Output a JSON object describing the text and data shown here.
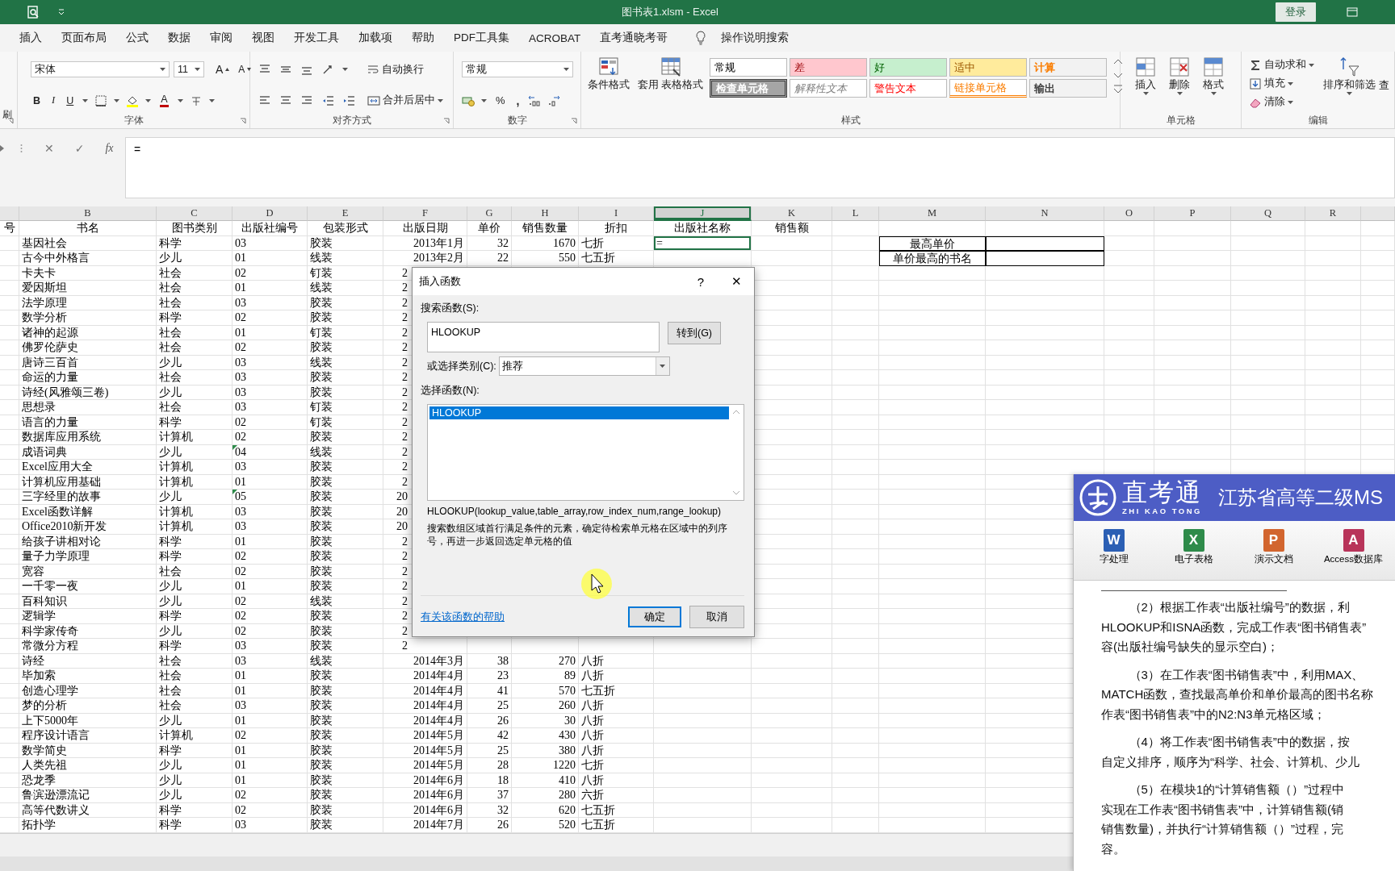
{
  "window": {
    "title": "图书表1.xlsm  -  Excel",
    "login": "登录"
  },
  "menu_tabs": [
    {
      "label": "插入",
      "selected": false
    },
    {
      "label": "页面布局",
      "selected": false
    },
    {
      "label": "公式",
      "selected": false
    },
    {
      "label": "数据",
      "selected": false
    },
    {
      "label": "审阅",
      "selected": false
    },
    {
      "label": "视图",
      "selected": false
    },
    {
      "label": "开发工具",
      "selected": false
    },
    {
      "label": "加载项",
      "selected": false
    },
    {
      "label": "帮助",
      "selected": false
    },
    {
      "label": "PDF工具集",
      "selected": false
    },
    {
      "label": "ACROBAT",
      "selected": false
    },
    {
      "label": "直考通晓考哥",
      "selected": false
    }
  ],
  "tell_me": "操作说明搜索",
  "ribbon": {
    "clipboard_stub": "刷",
    "font": {
      "label": "字体",
      "font_name": "宋体",
      "font_size": "11",
      "grow": "A",
      "shrink": "A",
      "bold": "B",
      "italic": "I",
      "underline": "U",
      "font_color": "A"
    },
    "alignment": {
      "label": "对齐方式",
      "wrap": "自动换行",
      "merge": "合并后居中"
    },
    "number": {
      "label": "数字",
      "format": "常规",
      "percent": "%",
      "comma": ","
    },
    "styles": {
      "label": "样式",
      "conditional": "条件格式",
      "table": "套用\n表格格式",
      "cell_styles": [
        {
          "label": "常规",
          "color": "#ffffff",
          "kind": "normal"
        },
        {
          "label": "差",
          "color": "#ffc7ce",
          "kind": "bad"
        },
        {
          "label": "好",
          "color": "#c6efce",
          "kind": "good"
        },
        {
          "label": "适中",
          "color": "#ffeb9c",
          "kind": "neutral"
        },
        {
          "label": "计算",
          "color": "#f2f2f2",
          "kind": "calculation"
        },
        {
          "label": "检查单元格",
          "color": "#a5a5a5",
          "kind": "check"
        },
        {
          "label": "解释性文本",
          "color": "#ffffff",
          "kind": "explanatory"
        },
        {
          "label": "警告文本",
          "color": "#ffffff",
          "kind": "warning"
        },
        {
          "label": "链接单元格",
          "color": "#ffffff",
          "kind": "linked"
        },
        {
          "label": "输出",
          "color": "#f2f2f2",
          "kind": "output"
        }
      ]
    },
    "cells": {
      "label": "单元格",
      "buttons": [
        "插入",
        "删除",
        "格式"
      ]
    },
    "editing": {
      "label": "编辑",
      "autosum": "自动求和",
      "fill": "填充",
      "clear": "清除",
      "sort": "排序和筛选",
      "find": "查"
    }
  },
  "formula_bar": {
    "cancel": "✕",
    "enter": "✓",
    "function": "fx",
    "value": "="
  },
  "sheet": {
    "columns": [
      "B",
      "C",
      "D",
      "E",
      "F",
      "G",
      "H",
      "I",
      "J",
      "K",
      "L",
      "M",
      "N",
      "O",
      "P",
      "Q",
      "R"
    ],
    "summary_labels": [
      "最高单价",
      "单价最高的书名"
    ],
    "rows": [
      {
        "A": "号",
        "B": "书名",
        "C": "图书类别",
        "D": "出版社编号",
        "E": "包装形式",
        "F": "出版日期",
        "G": "单价",
        "H": "销售数量",
        "I": "折扣",
        "J": "出版社名称",
        "K": "销售额"
      },
      {
        "B": "基因社会",
        "C": "科学",
        "D": "03",
        "E": "胶装",
        "F": "2013年1月",
        "G": "32",
        "H": "1670",
        "I": "七折",
        "J": {
          "text": "=",
          "selected": true
        }
      },
      {
        "B": "古今中外格言",
        "C": "少儿",
        "D": "01",
        "E": "线装",
        "F": "2013年2月",
        "G": "22",
        "H": "550",
        "I": "七五折"
      },
      {
        "B": "卡夫卡",
        "C": "社会",
        "D": "02",
        "E": "钉装",
        "F": {
          "text": "2",
          "partial": true
        }
      },
      {
        "B": "爱因斯坦",
        "C": "社会",
        "D": "01",
        "E": "线装",
        "F": {
          "text": "2",
          "partial": true
        }
      },
      {
        "B": "法学原理",
        "C": "社会",
        "D": "03",
        "E": "胶装",
        "F": {
          "text": "2",
          "partial": true
        }
      },
      {
        "B": "数学分析",
        "C": "科学",
        "D": "02",
        "E": "胶装",
        "F": {
          "text": "2",
          "partial": true
        }
      },
      {
        "B": "诸神的起源",
        "C": "社会",
        "D": "01",
        "E": "钉装",
        "F": {
          "text": "2",
          "partial": true
        }
      },
      {
        "B": "佛罗伦萨史",
        "C": "社会",
        "D": "02",
        "E": "胶装",
        "F": {
          "text": "2",
          "partial": true
        }
      },
      {
        "B": "唐诗三百首",
        "C": "少儿",
        "D": "03",
        "E": "线装",
        "F": {
          "text": "2",
          "partial": true
        }
      },
      {
        "B": "命运的力量",
        "C": "社会",
        "D": "03",
        "E": "胶装",
        "F": {
          "text": "2",
          "partial": true
        }
      },
      {
        "B": "诗经(风雅颂三卷)",
        "C": "少儿",
        "D": "03",
        "E": "胶装",
        "F": {
          "text": "2",
          "partial": true
        }
      },
      {
        "B": "思想录",
        "C": "社会",
        "D": "03",
        "E": "钉装",
        "F": {
          "text": "2",
          "partial": true
        }
      },
      {
        "B": "语言的力量",
        "C": "科学",
        "D": "02",
        "E": "钉装",
        "F": {
          "text": "2",
          "partial": true
        }
      },
      {
        "B": "数据库应用系统",
        "C": "计算机",
        "D": "02",
        "E": "胶装",
        "F": {
          "text": "2",
          "partial": true
        }
      },
      {
        "B": "成语词典",
        "C": "少儿",
        "D": {
          "text": "04",
          "error_flag": true
        },
        "E": "线装",
        "F": {
          "text": "2",
          "partial": true
        }
      },
      {
        "B": "Excel应用大全",
        "C": "计算机",
        "D": "03",
        "E": "胶装",
        "F": {
          "text": "2",
          "partial": true
        }
      },
      {
        "B": "计算机应用基础",
        "C": "计算机",
        "D": "01",
        "E": "胶装",
        "F": {
          "text": "2",
          "partial": true
        }
      },
      {
        "B": "三字经里的故事",
        "C": "少儿",
        "D": {
          "text": "05",
          "error_flag": true
        },
        "E": "胶装",
        "F": {
          "text": "20",
          "partial": true
        }
      },
      {
        "B": "Excel函数详解",
        "C": "计算机",
        "D": "03",
        "E": "胶装",
        "F": {
          "text": "20",
          "partial": true
        }
      },
      {
        "B": "Office2010新开发",
        "C": "计算机",
        "D": "03",
        "E": "胶装",
        "F": {
          "text": "20",
          "partial": true
        }
      },
      {
        "B": "给孩子讲相对论",
        "C": "科学",
        "D": "01",
        "E": "胶装",
        "F": {
          "text": "2",
          "partial": true
        }
      },
      {
        "B": "量子力学原理",
        "C": "科学",
        "D": "02",
        "E": "胶装",
        "F": {
          "text": "2",
          "partial": true
        }
      },
      {
        "B": "宽容",
        "C": "社会",
        "D": "02",
        "E": "胶装",
        "F": {
          "text": "2",
          "partial": true
        }
      },
      {
        "B": "一千零一夜",
        "C": "少儿",
        "D": "01",
        "E": "胶装",
        "F": {
          "text": "2",
          "partial": true
        }
      },
      {
        "B": "百科知识",
        "C": "少儿",
        "D": "02",
        "E": "线装",
        "F": {
          "text": "2",
          "partial": true
        }
      },
      {
        "B": "逻辑学",
        "C": "科学",
        "D": "02",
        "E": "胶装",
        "F": {
          "text": "2",
          "partial": true
        }
      },
      {
        "B": "科学家传奇",
        "C": "少儿",
        "D": "02",
        "E": "胶装",
        "F": {
          "text": "2",
          "partial": true
        }
      },
      {
        "B": "常微分方程",
        "C": "科学",
        "D": "03",
        "E": "胶装",
        "F": {
          "text": "2",
          "partial": true
        }
      },
      {
        "B": "诗经",
        "C": "社会",
        "D": "03",
        "E": "线装",
        "F": "2014年3月",
        "G": "38",
        "H": "270",
        "I": "八折"
      },
      {
        "B": "毕加索",
        "C": "社会",
        "D": "01",
        "E": "胶装",
        "F": "2014年4月",
        "G": "23",
        "H": "89",
        "I": "八折"
      },
      {
        "B": "创造心理学",
        "C": "社会",
        "D": "01",
        "E": "胶装",
        "F": "2014年4月",
        "G": "41",
        "H": "570",
        "I": "七五折"
      },
      {
        "B": "梦的分析",
        "C": "社会",
        "D": "03",
        "E": "胶装",
        "F": "2014年4月",
        "G": "25",
        "H": "260",
        "I": "八折"
      },
      {
        "B": "上下5000年",
        "C": "少儿",
        "D": "01",
        "E": "胶装",
        "F": "2014年4月",
        "G": "26",
        "H": "30",
        "I": "八折"
      },
      {
        "B": "程序设计语言",
        "C": "计算机",
        "D": "02",
        "E": "胶装",
        "F": "2014年5月",
        "G": "42",
        "H": "430",
        "I": "八折"
      },
      {
        "B": "数学简史",
        "C": "科学",
        "D": "01",
        "E": "胶装",
        "F": "2014年5月",
        "G": "25",
        "H": "380",
        "I": "八折"
      },
      {
        "B": "人类先祖",
        "C": "少儿",
        "D": "01",
        "E": "胶装",
        "F": "2014年5月",
        "G": "28",
        "H": "1220",
        "I": "七折"
      },
      {
        "B": "恐龙季",
        "C": "少儿",
        "D": "01",
        "E": "胶装",
        "F": "2014年6月",
        "G": "18",
        "H": "410",
        "I": "八折"
      },
      {
        "B": "鲁滨逊漂流记",
        "C": "少儿",
        "D": "02",
        "E": "胶装",
        "F": "2014年6月",
        "G": "37",
        "H": "280",
        "I": "六折"
      },
      {
        "B": "高等代数讲义",
        "C": "科学",
        "D": "02",
        "E": "胶装",
        "F": "2014年6月",
        "G": "32",
        "H": "620",
        "I": "七五折"
      },
      {
        "B": "拓扑学",
        "C": "科学",
        "D": "03",
        "E": "胶装",
        "F": "2014年7月",
        "G": "26",
        "H": "520",
        "I": "七五折"
      }
    ]
  },
  "dialog": {
    "title": "插入函数",
    "help": "?",
    "close": "✕",
    "search_label": "搜索函数(S):",
    "search_value": "HLOOKUP",
    "go": "转到(G)",
    "category_label": "或选择类别(C):",
    "category_value": "推荐",
    "list_label": "选择函数(N):",
    "functions": [
      {
        "label": "HLOOKUP",
        "selected": true
      }
    ],
    "signature": "HLOOKUP(lookup_value,table_array,row_index_num,range_lookup)",
    "description": "搜索数组区域首行满足条件的元素，确定待检索单元格在区域中的列序号，再进一步返回选定单元格的值",
    "help_link": "有关该函数的帮助",
    "ok": "确定",
    "cancel": "取消"
  },
  "panel": {
    "brand": "直考通",
    "brand_latin": "ZHI KAO TONG",
    "title": "江苏省高等二级MS",
    "apps": [
      {
        "letter": "W",
        "label": "字处理",
        "color": "#2b5fb4"
      },
      {
        "letter": "X",
        "label": "电子表格",
        "color": "#2e8b4a"
      },
      {
        "letter": "P",
        "label": "演示文档",
        "color": "#d2652e"
      },
      {
        "letter": "A",
        "label": "Access数据库",
        "color": "#b8345a"
      }
    ],
    "paragraphs": [
      {
        "lines": [
          "（2）根据工作表“出版社编号”的数据，利",
          "HLOOKUP和ISNA函数，完成工作表“图书销售表”",
          "容(出版社编号缺失的显示空白)；"
        ]
      },
      {
        "lines": [
          "（3）在工作表“图书销售表”中，利用MAX、",
          "MATCH函数，查找最高单价和单价最高的图书名称",
          "作表“图书销售表”中的N2:N3单元格区域；"
        ]
      },
      {
        "lines": [
          "（4）将工作表“图书销售表”中的数据，按",
          "自定义排序，顺序为“科学、社会、计算机、少儿"
        ]
      },
      {
        "lines": [
          "（5）在模块1的“计算销售额（）”过程中",
          "实现在工作表“图书销售表”中，计算销售额(销",
          "销售数量)，并执行“计算销售额（）”过程，完",
          "容。"
        ]
      }
    ]
  }
}
